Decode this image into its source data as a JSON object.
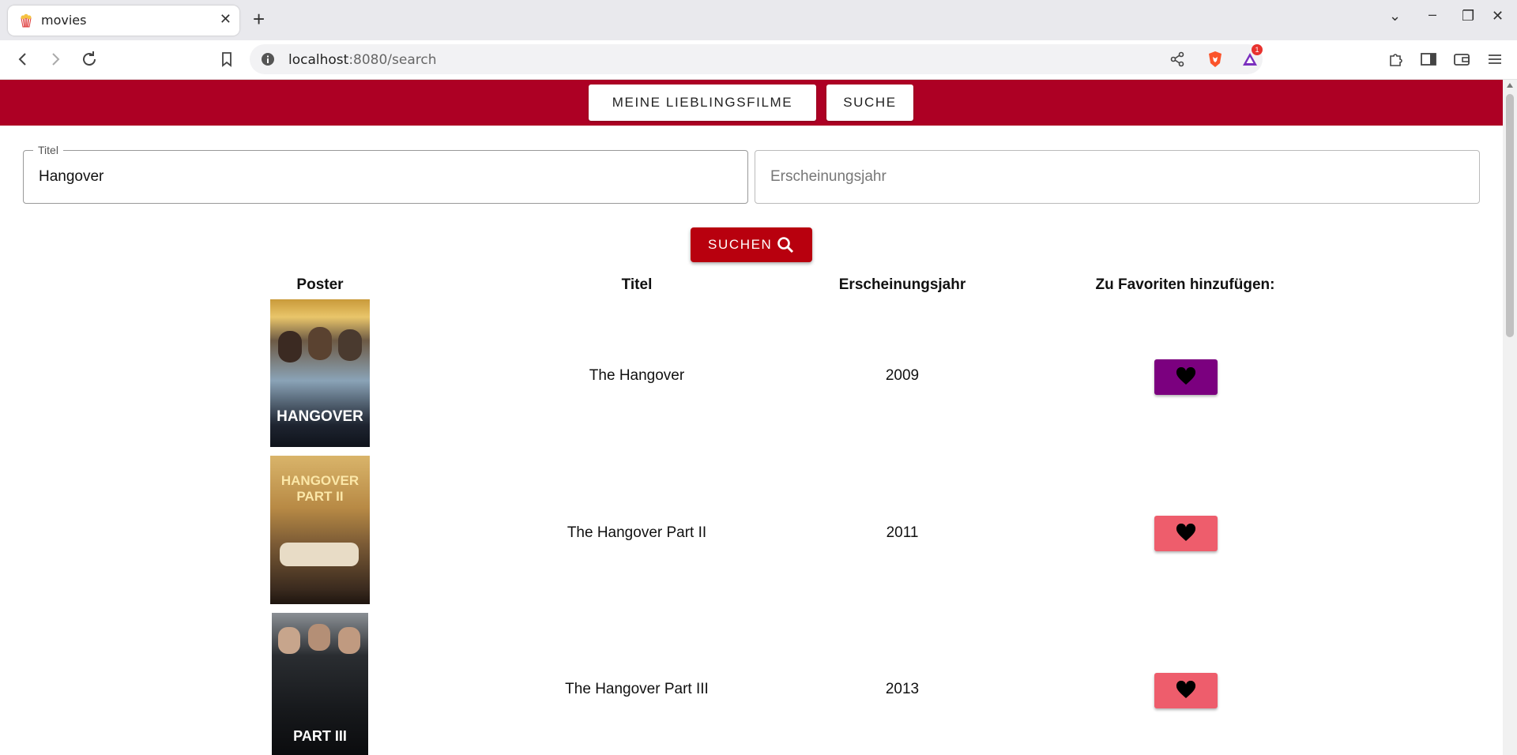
{
  "browser": {
    "tab_title": "movies",
    "url_host": "localhost",
    "url_port_path": ":8080/search",
    "brave_badge": "1"
  },
  "nav": {
    "favorites_label": "MEINE LIEBLINGSFILME",
    "search_label": "SUCHE"
  },
  "form": {
    "title_legend": "Titel",
    "title_value": "Hangover",
    "year_placeholder": "Erscheinungsjahr",
    "search_button_label": "SUCHEN"
  },
  "table": {
    "headers": [
      "Poster",
      "Titel",
      "Erscheinungsjahr",
      "Zu Favoriten hinzufügen:"
    ],
    "rows": [
      {
        "title": "The Hangover",
        "year": "2009",
        "poster_text": "HANGOVER",
        "favorite": true
      },
      {
        "title": "The Hangover Part II",
        "year": "2011",
        "poster_text": "HANGOVER PART II",
        "favorite": false
      },
      {
        "title": "The Hangover Part III",
        "year": "2013",
        "poster_text": "PART III",
        "favorite": false
      }
    ]
  },
  "colors": {
    "header_red": "#ad0024",
    "search_red": "#b8000e",
    "fav_active": "#7b007f",
    "fav_inactive": "#ee5d6c"
  }
}
